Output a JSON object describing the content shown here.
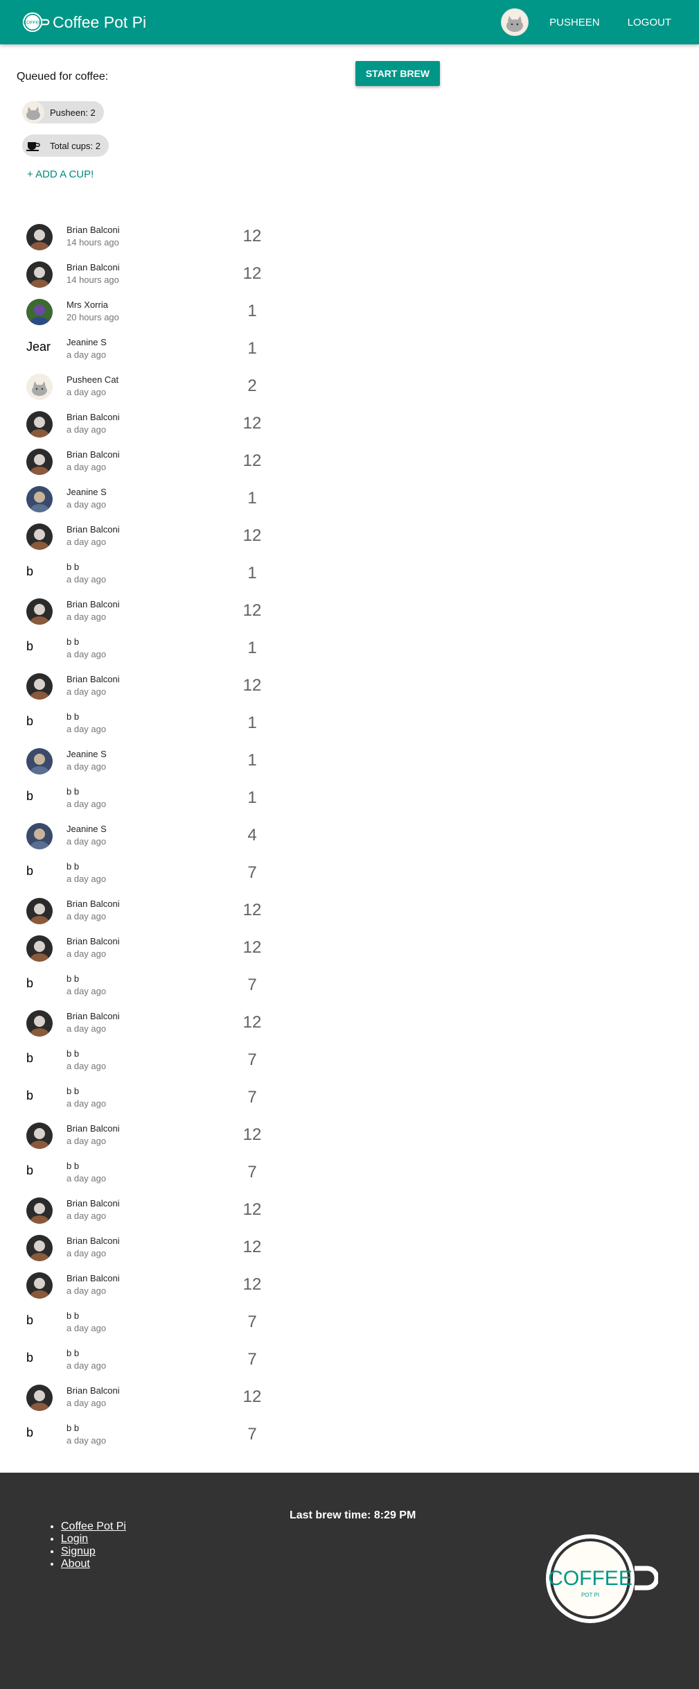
{
  "header": {
    "title": "Coffee Pot Pi",
    "user_label": "PUSHEEN",
    "logout_label": "LOGOUT"
  },
  "queue": {
    "label": "Queued for coffee:",
    "start_brew_label": "START BREW",
    "chips": [
      {
        "text": "Pusheen: 2",
        "icon": "pusheen-avatar"
      },
      {
        "text": "Total cups: 2",
        "icon": "coffee-cup-icon"
      }
    ],
    "add_cup_label": "+ ADD A CUP!"
  },
  "brews": [
    {
      "name": "Brian Balconi",
      "time": "14 hours ago",
      "cups": "12",
      "avatar": "photo-brian"
    },
    {
      "name": "Brian Balconi",
      "time": "14 hours ago",
      "cups": "12",
      "avatar": "photo-brian"
    },
    {
      "name": "Mrs Xorria",
      "time": "20 hours ago",
      "cups": "1",
      "avatar": "photo-xorria"
    },
    {
      "name": "Jeanine S",
      "time": "a day ago",
      "cups": "1",
      "avatar": "letter",
      "letter": "Jear"
    },
    {
      "name": "Pusheen Cat",
      "time": "a day ago",
      "cups": "2",
      "avatar": "photo-pusheen"
    },
    {
      "name": "Brian Balconi",
      "time": "a day ago",
      "cups": "12",
      "avatar": "photo-brian"
    },
    {
      "name": "Brian Balconi",
      "time": "a day ago",
      "cups": "12",
      "avatar": "photo-brian"
    },
    {
      "name": "Jeanine S",
      "time": "a day ago",
      "cups": "1",
      "avatar": "photo-jeanine"
    },
    {
      "name": "Brian Balconi",
      "time": "a day ago",
      "cups": "12",
      "avatar": "photo-brian"
    },
    {
      "name": "b b",
      "time": "a day ago",
      "cups": "1",
      "avatar": "letter",
      "letter": "b"
    },
    {
      "name": "Brian Balconi",
      "time": "a day ago",
      "cups": "12",
      "avatar": "photo-brian"
    },
    {
      "name": "b b",
      "time": "a day ago",
      "cups": "1",
      "avatar": "letter",
      "letter": "b"
    },
    {
      "name": "Brian Balconi",
      "time": "a day ago",
      "cups": "12",
      "avatar": "photo-brian"
    },
    {
      "name": "b b",
      "time": "a day ago",
      "cups": "1",
      "avatar": "letter",
      "letter": "b"
    },
    {
      "name": "Jeanine S",
      "time": "a day ago",
      "cups": "1",
      "avatar": "photo-jeanine"
    },
    {
      "name": "b b",
      "time": "a day ago",
      "cups": "1",
      "avatar": "letter",
      "letter": "b"
    },
    {
      "name": "Jeanine S",
      "time": "a day ago",
      "cups": "4",
      "avatar": "photo-jeanine"
    },
    {
      "name": "b b",
      "time": "a day ago",
      "cups": "7",
      "avatar": "letter",
      "letter": "b"
    },
    {
      "name": "Brian Balconi",
      "time": "a day ago",
      "cups": "12",
      "avatar": "photo-brian"
    },
    {
      "name": "Brian Balconi",
      "time": "a day ago",
      "cups": "12",
      "avatar": "photo-brian"
    },
    {
      "name": "b b",
      "time": "a day ago",
      "cups": "7",
      "avatar": "letter",
      "letter": "b"
    },
    {
      "name": "Brian Balconi",
      "time": "a day ago",
      "cups": "12",
      "avatar": "photo-brian"
    },
    {
      "name": "b b",
      "time": "a day ago",
      "cups": "7",
      "avatar": "letter",
      "letter": "b"
    },
    {
      "name": "b b",
      "time": "a day ago",
      "cups": "7",
      "avatar": "letter",
      "letter": "b"
    },
    {
      "name": "Brian Balconi",
      "time": "a day ago",
      "cups": "12",
      "avatar": "photo-brian"
    },
    {
      "name": "b b",
      "time": "a day ago",
      "cups": "7",
      "avatar": "letter",
      "letter": "b"
    },
    {
      "name": "Brian Balconi",
      "time": "a day ago",
      "cups": "12",
      "avatar": "photo-brian"
    },
    {
      "name": "Brian Balconi",
      "time": "a day ago",
      "cups": "12",
      "avatar": "photo-brian"
    },
    {
      "name": "Brian Balconi",
      "time": "a day ago",
      "cups": "12",
      "avatar": "photo-brian"
    },
    {
      "name": "b b",
      "time": "a day ago",
      "cups": "7",
      "avatar": "letter",
      "letter": "b"
    },
    {
      "name": "b b",
      "time": "a day ago",
      "cups": "7",
      "avatar": "letter",
      "letter": "b"
    },
    {
      "name": "Brian Balconi",
      "time": "a day ago",
      "cups": "12",
      "avatar": "photo-brian"
    },
    {
      "name": "b b",
      "time": "a day ago",
      "cups": "7",
      "avatar": "letter",
      "letter": "b"
    }
  ],
  "footer": {
    "links": [
      "Coffee Pot Pi",
      "Login",
      "Signup",
      "About"
    ],
    "last_brew_prefix": "Last brew time: ",
    "last_brew_value": "8:29 PM",
    "logo_text": "COFFEE",
    "logo_subtext": "POT PI"
  },
  "colors": {
    "primary": "#009688",
    "accent_link": "#00897b",
    "footer_bg": "#333333",
    "chip_bg": "#e0e0e0"
  }
}
